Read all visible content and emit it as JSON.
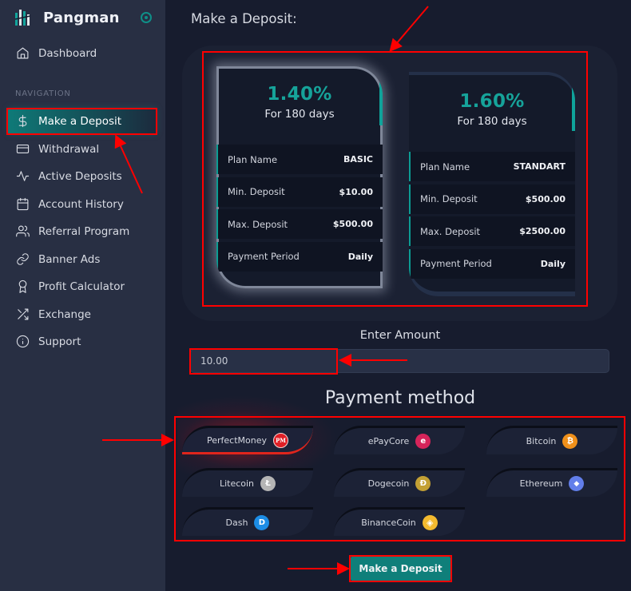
{
  "brand": {
    "name": "Pangman",
    "logo_icon": "bars-logo-icon",
    "toggle_icon": "radio-toggle-icon"
  },
  "sidebar": {
    "dashboard": {
      "label": "Dashboard",
      "icon": "home-icon"
    },
    "section_label": "NAVIGATION",
    "items": [
      {
        "label": "Make a Deposit",
        "icon": "dollar-icon",
        "active": true
      },
      {
        "label": "Withdrawal",
        "icon": "credit-card-icon"
      },
      {
        "label": "Active Deposits",
        "icon": "activity-icon"
      },
      {
        "label": "Account History",
        "icon": "calendar-icon"
      },
      {
        "label": "Referral Program",
        "icon": "users-icon"
      },
      {
        "label": "Banner Ads",
        "icon": "link-icon"
      },
      {
        "label": "Profit Calculator",
        "icon": "award-icon"
      },
      {
        "label": "Exchange",
        "icon": "shuffle-icon"
      },
      {
        "label": "Support",
        "icon": "info-icon"
      }
    ]
  },
  "main": {
    "title": "Make a Deposit:",
    "plans": [
      {
        "rate": "1.40%",
        "duration": "For 180 days",
        "selected": true,
        "rows": [
          {
            "label": "Plan Name",
            "value": "BASIC"
          },
          {
            "label": "Min. Deposit",
            "value": "$10.00"
          },
          {
            "label": "Max. Deposit",
            "value": "$500.00"
          },
          {
            "label": "Payment Period",
            "value": "Daily"
          }
        ]
      },
      {
        "rate": "1.60%",
        "duration": "For 180 days",
        "selected": false,
        "rows": [
          {
            "label": "Plan Name",
            "value": "STANDART"
          },
          {
            "label": "Min. Deposit",
            "value": "$500.00"
          },
          {
            "label": "Max. Deposit",
            "value": "$2500.00"
          },
          {
            "label": "Payment Period",
            "value": "Daily"
          }
        ]
      }
    ],
    "amount": {
      "label": "Enter Amount",
      "value": "10.00"
    },
    "payment": {
      "title": "Payment method",
      "methods": [
        {
          "name": "PerfectMoney",
          "icon": "perfectmoney-icon",
          "glyph": "PM",
          "color": "#e01f26",
          "selected": true
        },
        {
          "name": "ePayCore",
          "icon": "epaycore-icon",
          "glyph": "e",
          "color": "#d6245a"
        },
        {
          "name": "Bitcoin",
          "icon": "bitcoin-icon",
          "glyph": "₿",
          "color": "#f0901a"
        },
        {
          "name": "Litecoin",
          "icon": "litecoin-icon",
          "glyph": "Ł",
          "color": "#b5b5b5"
        },
        {
          "name": "Dogecoin",
          "icon": "dogecoin-icon",
          "glyph": "Ð",
          "color": "#c3a034"
        },
        {
          "name": "Ethereum",
          "icon": "ethereum-icon",
          "glyph": "◆",
          "color": "#627eea"
        },
        {
          "name": "Dash",
          "icon": "dash-icon",
          "glyph": "D",
          "color": "#1c8de6"
        },
        {
          "name": "BinanceCoin",
          "icon": "binancecoin-icon",
          "glyph": "◈",
          "color": "#f3ba2f"
        }
      ]
    },
    "submit_label": "Make a Deposit"
  },
  "colors": {
    "accent": "#0fa39a",
    "annotation": "#ff0000",
    "sidebar_bg": "#282f43",
    "main_bg": "#171c2e"
  }
}
